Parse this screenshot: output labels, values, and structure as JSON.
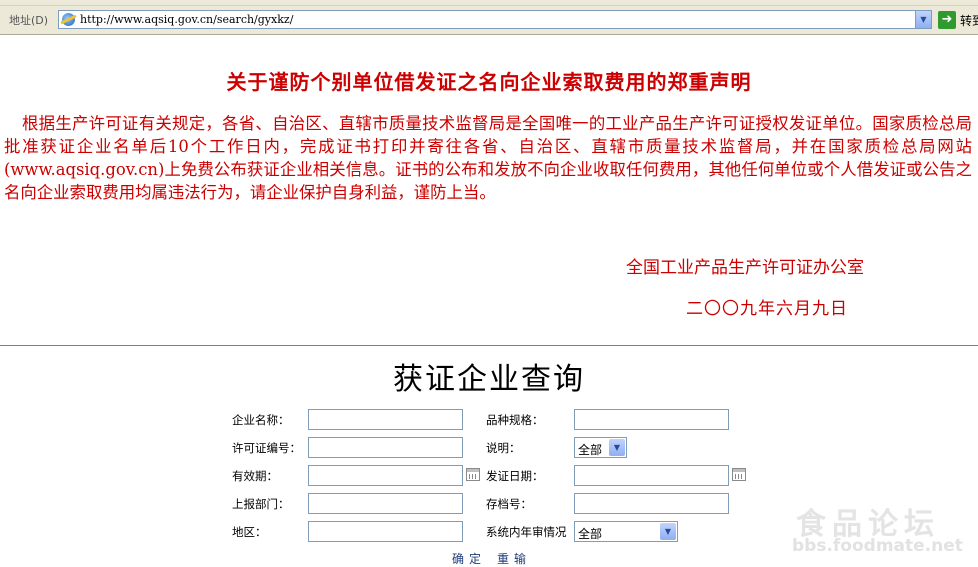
{
  "browser": {
    "address_label": "地址(D)",
    "url": "http://www.aqsiq.gov.cn/search/gyxkz/",
    "go_label": "转到"
  },
  "notice": {
    "title": "关于谨防个别单位借发证之名向企业索取费用的郑重声明",
    "body": "根据生产许可证有关规定，各省、自治区、直辖市质量技术监督局是全国唯一的工业产品生产许可证授权发证单位。国家质检总局批准获证企业名单后10个工作日内，完成证书打印并寄往各省、自治区、直辖市质量技术监督局，并在国家质检总局网站(www.aqsiq.gov.cn)上免费公布获证企业相关信息。证书的公布和发放不向企业收取任何费用，其他任何单位或个人借发证或公告之名向企业索取费用均属违法行为，请企业保护自身利益，谨防上当。",
    "office": "全国工业产品生产许可证办公室",
    "date": "二〇〇九年六月九日"
  },
  "query": {
    "title": "获证企业查询",
    "fields": {
      "company_name": {
        "label": "企业名称：",
        "value": ""
      },
      "product_spec": {
        "label": "品种规格：",
        "value": ""
      },
      "license_no": {
        "label": "许可证编号：",
        "value": ""
      },
      "description": {
        "label": "说明：",
        "value": "全部"
      },
      "validity": {
        "label": "有效期：",
        "value": ""
      },
      "issue_date": {
        "label": "发证日期：",
        "value": ""
      },
      "report_dept": {
        "label": "上报部门：",
        "value": ""
      },
      "archive_no": {
        "label": "存档号：",
        "value": ""
      },
      "region": {
        "label": "地区：",
        "value": ""
      },
      "annual_review": {
        "label": "系统内年审情况",
        "value": "全部"
      }
    },
    "buttons": {
      "confirm": "确定",
      "reset": "重输"
    }
  },
  "watermark": {
    "cn": "食品论坛",
    "en": "bbs.foodmate.net"
  },
  "colors": {
    "notice_red": "#cc0000",
    "link_blue": "#1e3c7a",
    "chrome": "#ece9d8"
  }
}
